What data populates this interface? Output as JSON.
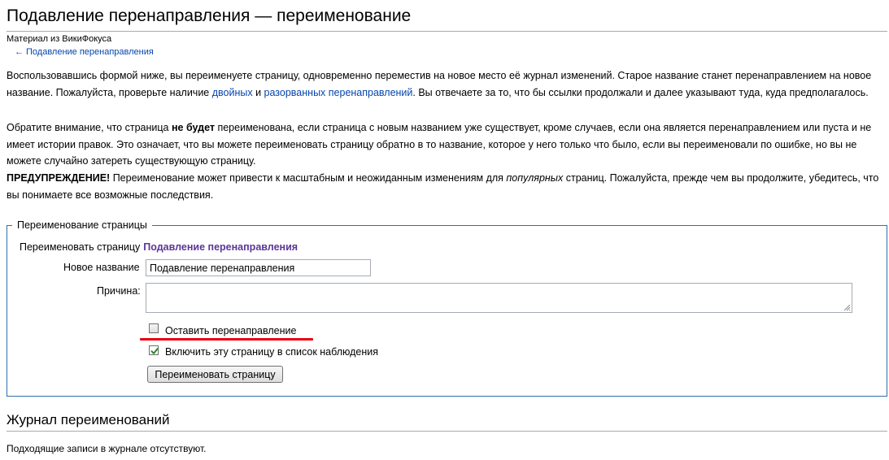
{
  "page": {
    "title": "Подавление перенаправления — переименование",
    "subtitle": "Материал из ВикиФокуса",
    "redirect_back_arrow": "←",
    "redirect_back_link": "Подавление перенаправления"
  },
  "intro": {
    "p1_part1": "Воспользовавшись формой ниже, вы переименуете страницу, одновременно переместив на новое место её журнал изменений. Старое название станет перенаправлением на новое название. Пожалуйста, проверьте наличие ",
    "p1_link1": "двойных",
    "p1_and": " и ",
    "p1_link2": "разорванных перенаправлений",
    "p1_part2": ". Вы отвечаете за то, что бы ссылки продолжали и далее указывают туда, куда предполагалось.",
    "p2_part1": "Обратите внимание, что страница ",
    "p2_bold": "не будет",
    "p2_part2": " переименована, если страница с новым названием уже существует, кроме случаев, если она является перенаправлением или пуста и не имеет истории правок. Это означает, что вы можете переименовать страницу обратно в то название, которое у него только что было, если вы переименовали по ошибке, но вы не можете случайно затереть существующую страницу.",
    "p3_bold": "ПРЕДУПРЕЖДЕНИЕ!",
    "p3_part1": " Переименование может привести к масштабным и неожиданным изменениям для ",
    "p3_italic": "популярных",
    "p3_part2": " страниц. Пожалуйста, прежде чем вы продолжите, убедитесь, что вы понимаете все возможные последствия."
  },
  "form": {
    "legend": "Переименование страницы",
    "rename_label": "Переименовать страницу",
    "rename_page_link": "Подавление перенаправления",
    "new_name_label": "Новое название",
    "new_name_value": "Подавление перенаправления",
    "reason_label": "Причина:",
    "reason_value": "",
    "leave_redirect_label": "Оставить перенаправление",
    "leave_redirect_checked": false,
    "watch_label": "Включить эту страницу в список наблюдения",
    "watch_checked": true,
    "submit_label": "Переименовать страницу"
  },
  "log": {
    "heading": "Журнал переименований",
    "empty_text": "Подходящие записи в журнале отсутствуют."
  },
  "colors": {
    "link": "#0645ad",
    "visited_link": "#5a3696",
    "fieldset_border": "#2f6fab",
    "highlight_underline": "#e8000b",
    "checkmark": "#2a8a2a"
  },
  "icons": {
    "back_arrow": "arrow-left-icon",
    "checkmark": "checkmark-icon",
    "resize_grip": "resize-grip-icon"
  }
}
